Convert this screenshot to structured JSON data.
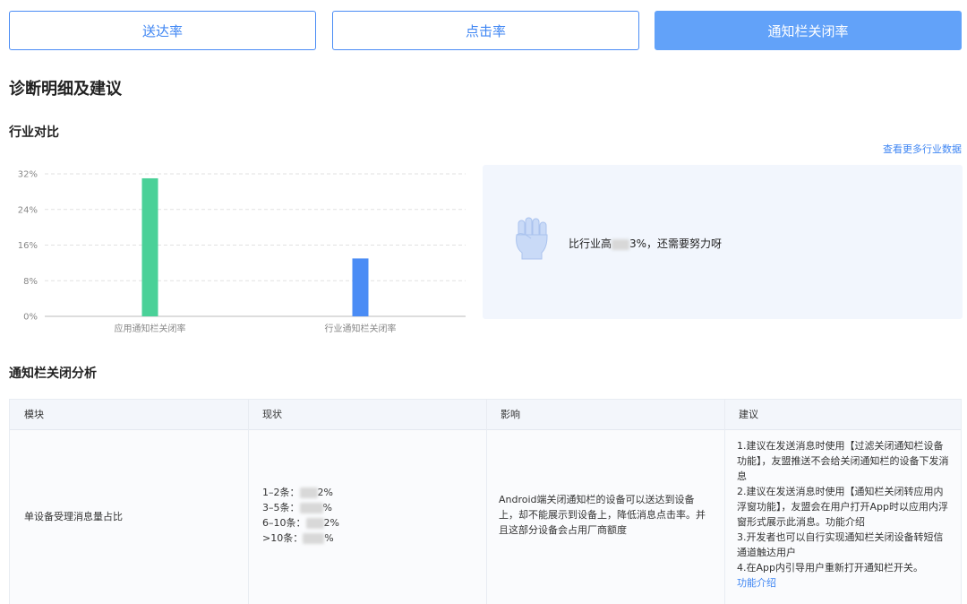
{
  "tabs": [
    "送达率",
    "点击率",
    "通知栏关闭率"
  ],
  "page_title": "诊断明细及建议",
  "industry_section": {
    "title": "行业对比",
    "more_link": "查看更多行业数据",
    "compare_prefix": "比行业高",
    "compare_suffix": "3%，还需要努力呀",
    "icon": "fist-icon"
  },
  "chart_data": {
    "type": "bar",
    "categories": [
      "应用通知栏关闭率",
      "行业通知栏关闭率"
    ],
    "values": [
      31,
      13
    ],
    "colors": [
      "#4ad198",
      "#4a8cf5"
    ],
    "yticks": [
      "0%",
      "8%",
      "16%",
      "24%",
      "32%"
    ],
    "ylim": [
      0,
      32
    ],
    "grid": true
  },
  "analysis": {
    "title": "通知栏关闭分析",
    "columns": [
      "模块",
      "现状",
      "影响",
      "建议"
    ],
    "row": {
      "module": "单设备受理消息量占比",
      "status": [
        {
          "label": "1–2条：",
          "suffix": "2%"
        },
        {
          "label": "3–5条：",
          "suffix": "%"
        },
        {
          "label": "6–10条：",
          "suffix": "2%"
        },
        {
          "label": ">10条：",
          "suffix": "%"
        }
      ],
      "impact": "Android端关闭通知栏的设备可以送达到设备上，却不能展示到设备上，降低消息点击率。并且这部分设备会占用厂商额度",
      "advice": [
        "1.建议在发送消息时使用【过滤关闭通知栏设备功能】，友盟推送不会给关闭通知栏的设备下发消息",
        "2.建议在发送消息时使用【通知栏关闭转应用内浮窗功能】，友盟会在用户打开App时以应用内浮窗形式展示此消息。功能介绍",
        "3.开发者也可以自行实现通知栏关闭设备转短信通道触达用户",
        "4.在App内引导用户重新打开通知栏开关。"
      ],
      "advice_link": "功能介绍"
    }
  }
}
